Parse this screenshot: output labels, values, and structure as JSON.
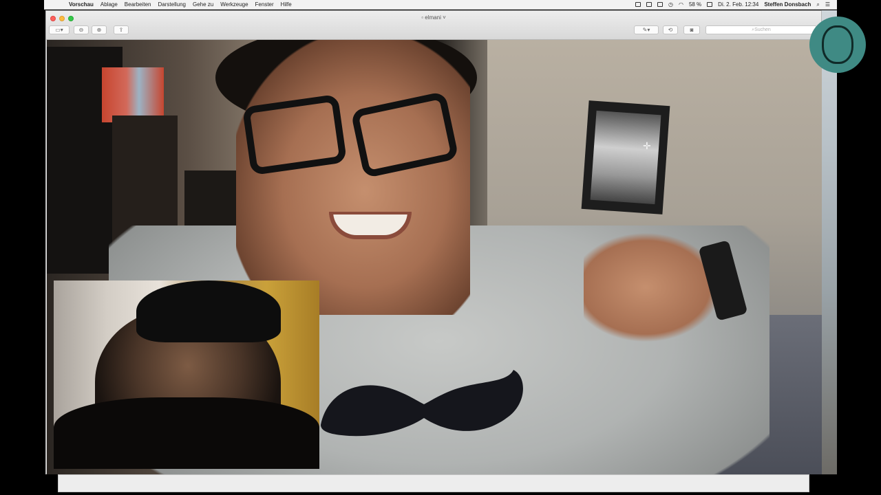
{
  "menubar": {
    "items": [
      "Vorschau",
      "Ablage",
      "Bearbeiten",
      "Darstellung",
      "Gehe zu",
      "Werkzeuge",
      "Fenster",
      "Hilfe"
    ],
    "status": {
      "battery": "58 %",
      "datetime": "Di. 2. Feb. 12:34",
      "user": "Steffen Donsbach"
    }
  },
  "window": {
    "title": "elmani",
    "search_placeholder": "Suchen"
  },
  "colors": {
    "close": "#fc605c",
    "minimize": "#fdbc40",
    "zoom": "#34c84a",
    "avatar_bg": "#3f8a84"
  },
  "icons": [
    "apple-icon",
    "sidebar-toggle-icon",
    "zoom-out-icon",
    "zoom-in-icon",
    "share-icon",
    "markup-pen-icon",
    "rotate-icon",
    "camera-icon",
    "search-icon",
    "wifi-icon",
    "battery-icon",
    "spotlight-icon",
    "notification-center-icon"
  ]
}
